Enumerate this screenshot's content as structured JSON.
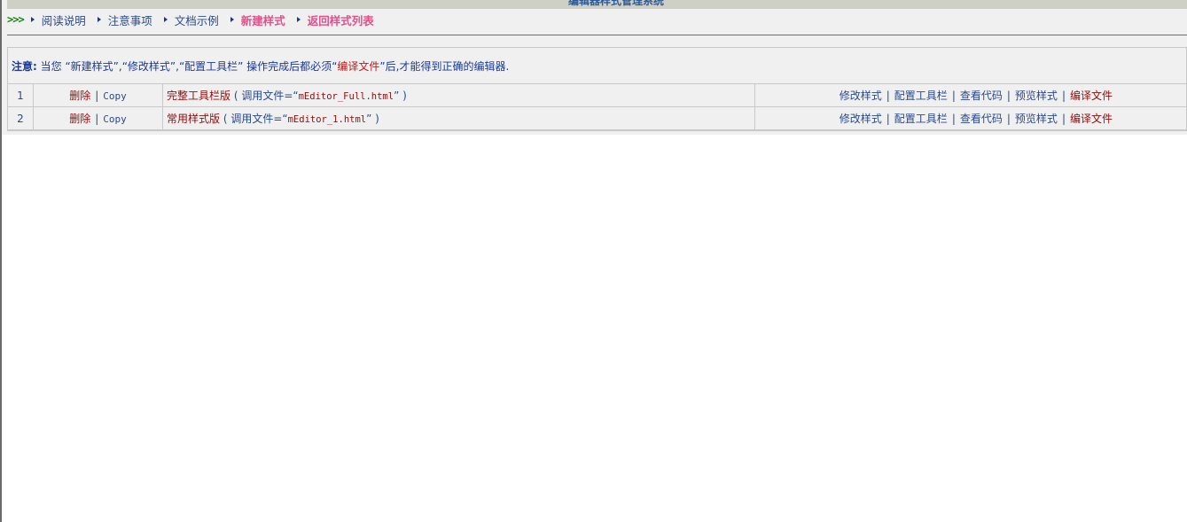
{
  "header": {
    "title": "编辑器样式管理系统"
  },
  "nav": {
    "chevrons": ">>>",
    "items": [
      {
        "label": "阅读说明"
      },
      {
        "label": "注意事项"
      },
      {
        "label": "文档示例"
      },
      {
        "label": "新建样式"
      },
      {
        "label": "返回样式列表"
      }
    ]
  },
  "notice": {
    "label": "注意:",
    "text_before": " 当您 “新建样式”,“修改样式”,“配置工具栏” 操作完成后都必须“",
    "highlight": "编译文件",
    "text_after": "”后,才能得到正确的编辑器."
  },
  "styles": {
    "actions": {
      "delete": "删除",
      "sep": "|",
      "copy": "Copy"
    },
    "ops": [
      "修改样式",
      "配置工具栏",
      "查看代码",
      "预览样式",
      "编译文件"
    ],
    "rows": [
      {
        "num": "1",
        "name": "完整工具栏版",
        "note_prefix": " ( 调用文件=“",
        "file": "mEditor_Full.html",
        "note_suffix": "” )"
      },
      {
        "num": "2",
        "name": "常用样式版",
        "note_prefix": " ( 调用文件=“",
        "file": "mEditor_1.html",
        "note_suffix": "” )"
      }
    ]
  },
  "colors": {
    "link_blue": "#2b4a8a",
    "link_red": "#8a1010",
    "hot_pink": "#e0508a",
    "chevron_green": "#118811",
    "rule_brown": "#a85a30"
  }
}
